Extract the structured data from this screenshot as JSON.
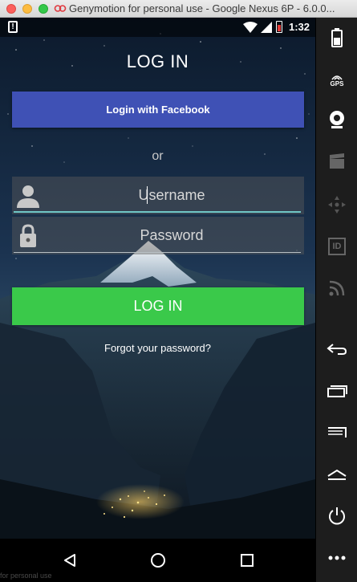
{
  "window": {
    "title": "Genymotion for personal use - Google Nexus 6P - 6.0.0..."
  },
  "status_bar": {
    "time": "1:32",
    "alert_glyph": "!"
  },
  "login": {
    "title": "LOG IN",
    "facebook_button": "Login with Facebook",
    "or_label": "or",
    "username_placeholder": "Username",
    "password_placeholder": "Password",
    "login_button": "LOG IN",
    "forgot_link": "Forgot your password?"
  },
  "sidebar": {
    "items": [
      {
        "icon": "battery-icon"
      },
      {
        "icon": "gps-icon",
        "label": "GPS"
      },
      {
        "icon": "webcam-icon"
      },
      {
        "icon": "video-capture-icon"
      },
      {
        "icon": "dpad-icon"
      },
      {
        "icon": "device-id-icon",
        "label": "ID"
      },
      {
        "icon": "network-icon"
      },
      {
        "icon": "back-icon"
      },
      {
        "icon": "recent-apps-icon"
      },
      {
        "icon": "menu-icon"
      },
      {
        "icon": "home-icon"
      },
      {
        "icon": "power-icon"
      },
      {
        "icon": "more-icon"
      }
    ]
  },
  "navigation": {
    "items": [
      "back-icon",
      "home-icon",
      "recents-icon"
    ]
  },
  "watermark": "for personal use",
  "colors": {
    "facebook_blue": "#3f51b5",
    "login_green": "#3ac94a",
    "field_underline_active": "#6fc6c6"
  }
}
